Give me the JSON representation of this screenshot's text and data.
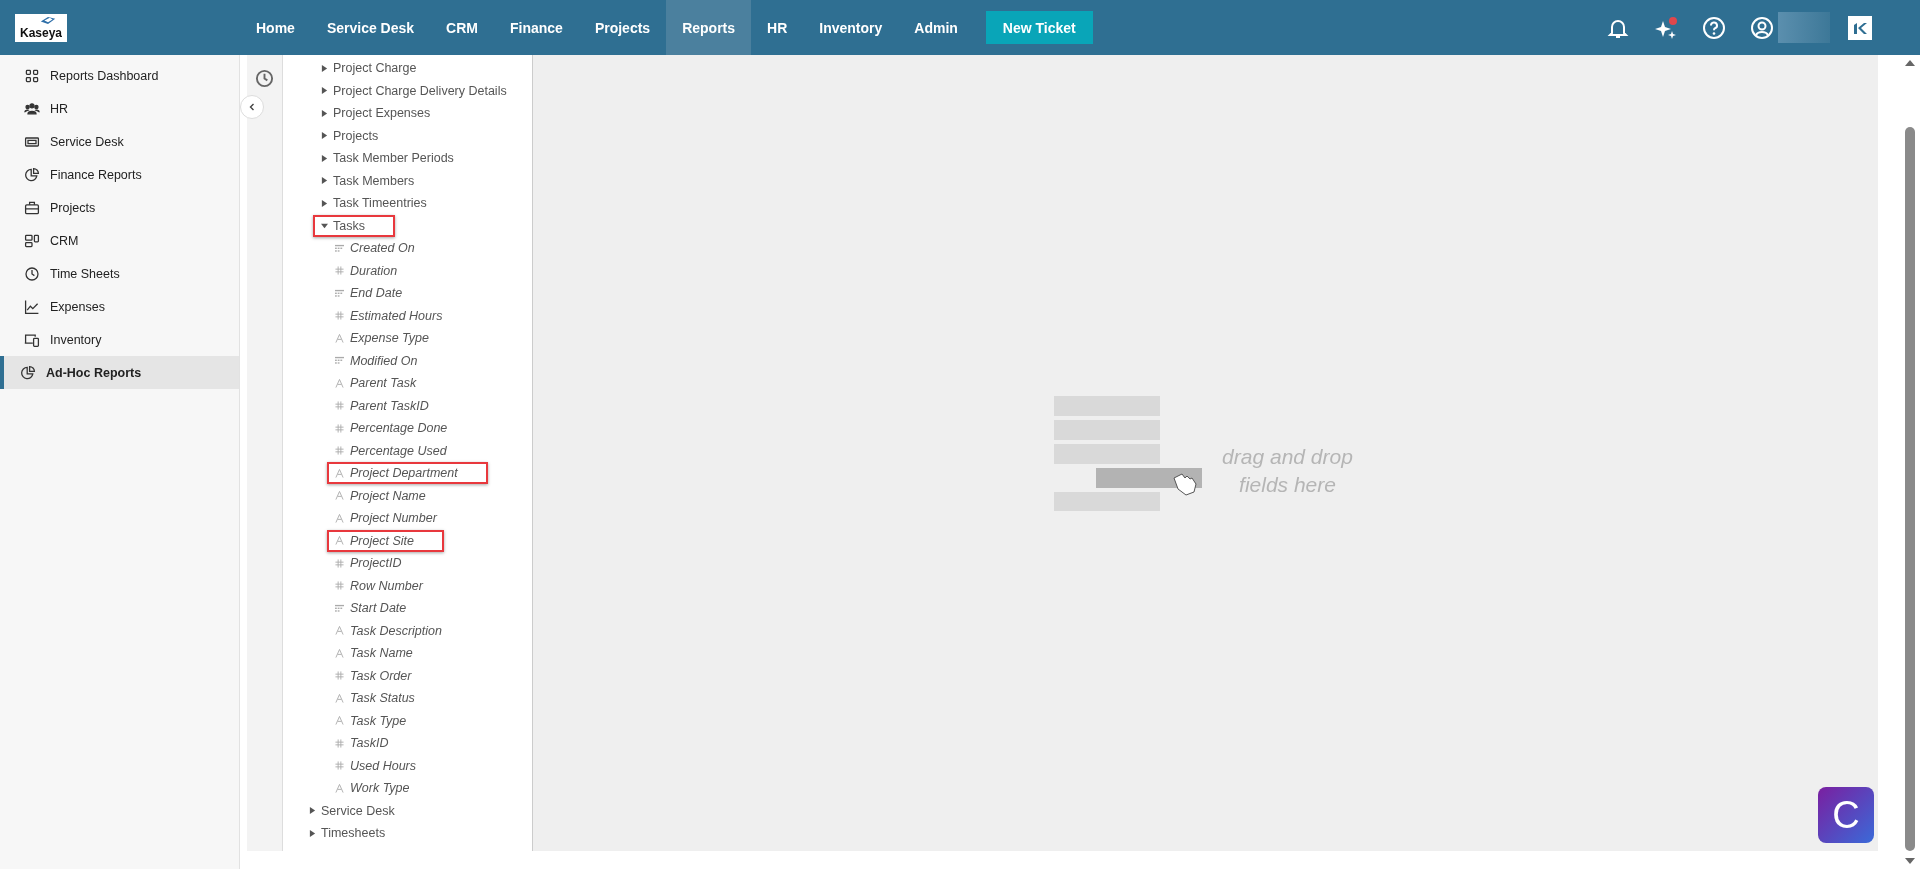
{
  "header": {
    "logo": "Kaseya",
    "nav": [
      {
        "label": "Home",
        "selected": false
      },
      {
        "label": "Service Desk",
        "selected": false
      },
      {
        "label": "CRM",
        "selected": false
      },
      {
        "label": "Finance",
        "selected": false
      },
      {
        "label": "Projects",
        "selected": false
      },
      {
        "label": "Reports",
        "selected": true
      },
      {
        "label": "HR",
        "selected": false
      },
      {
        "label": "Inventory",
        "selected": false
      },
      {
        "label": "Admin",
        "selected": false
      }
    ],
    "action_button": "New Ticket",
    "notification_dot": true
  },
  "sidebar": {
    "items": [
      {
        "label": "Reports Dashboard",
        "selected": false
      },
      {
        "label": "HR",
        "selected": false
      },
      {
        "label": "Service Desk",
        "selected": false
      },
      {
        "label": "Finance Reports",
        "selected": false
      },
      {
        "label": "Projects",
        "selected": false
      },
      {
        "label": "CRM",
        "selected": false
      },
      {
        "label": "Time Sheets",
        "selected": false
      },
      {
        "label": "Expenses",
        "selected": false
      },
      {
        "label": "Inventory",
        "selected": false
      },
      {
        "label": "Ad-Hoc Reports",
        "selected": true
      }
    ]
  },
  "tree": {
    "nodes": [
      {
        "children": [
          {
            "label": "Project Charge",
            "expanded": false,
            "highlighted": false
          },
          {
            "label": "Project Charge Delivery Details",
            "expanded": false,
            "highlighted": false
          },
          {
            "label": "Project Expenses",
            "expanded": false,
            "highlighted": false
          },
          {
            "label": "Projects",
            "expanded": false,
            "highlighted": false
          },
          {
            "label": "Task Member Periods",
            "expanded": false,
            "highlighted": false
          },
          {
            "label": "Task Members",
            "expanded": false,
            "highlighted": false
          },
          {
            "label": "Task Timeentries",
            "expanded": false,
            "highlighted": false
          },
          {
            "label": "Tasks",
            "expanded": true,
            "highlighted": true,
            "children": [
              {
                "label": "Created On",
                "kind": "date",
                "highlighted": false
              },
              {
                "label": "Duration",
                "kind": "number",
                "highlighted": false
              },
              {
                "label": "End Date",
                "kind": "date",
                "highlighted": false
              },
              {
                "label": "Estimated Hours",
                "kind": "number",
                "highlighted": false
              },
              {
                "label": "Expense Type",
                "kind": "text",
                "highlighted": false
              },
              {
                "label": "Modified On",
                "kind": "date",
                "highlighted": false
              },
              {
                "label": "Parent Task",
                "kind": "text",
                "highlighted": false
              },
              {
                "label": "Parent TaskID",
                "kind": "number",
                "highlighted": false
              },
              {
                "label": "Percentage Done",
                "kind": "number",
                "highlighted": false
              },
              {
                "label": "Percentage Used",
                "kind": "number",
                "highlighted": false
              },
              {
                "label": "Project Department",
                "kind": "text",
                "highlighted": true
              },
              {
                "label": "Project Name",
                "kind": "text",
                "highlighted": false
              },
              {
                "label": "Project Number",
                "kind": "text",
                "highlighted": false
              },
              {
                "label": "Project Site",
                "kind": "text",
                "highlighted": true
              },
              {
                "label": "ProjectID",
                "kind": "number",
                "highlighted": false
              },
              {
                "label": "Row Number",
                "kind": "number",
                "highlighted": false
              },
              {
                "label": "Start Date",
                "kind": "date",
                "highlighted": false
              },
              {
                "label": "Task Description",
                "kind": "text",
                "highlighted": false
              },
              {
                "label": "Task Name",
                "kind": "text",
                "highlighted": false
              },
              {
                "label": "Task Order",
                "kind": "number",
                "highlighted": false
              },
              {
                "label": "Task Status",
                "kind": "text",
                "highlighted": false
              },
              {
                "label": "Task Type",
                "kind": "text",
                "highlighted": false
              },
              {
                "label": "TaskID",
                "kind": "number",
                "highlighted": false
              },
              {
                "label": "Used Hours",
                "kind": "number",
                "highlighted": false
              },
              {
                "label": "Work Type",
                "kind": "text",
                "highlighted": false
              }
            ]
          }
        ]
      },
      {
        "label": "Service Desk",
        "expanded": false,
        "highlighted": false
      },
      {
        "label": "Timesheets",
        "expanded": false,
        "highlighted": false
      }
    ]
  },
  "drop_area": {
    "hint": "drag and drop fields here"
  },
  "chat_button": "C"
}
